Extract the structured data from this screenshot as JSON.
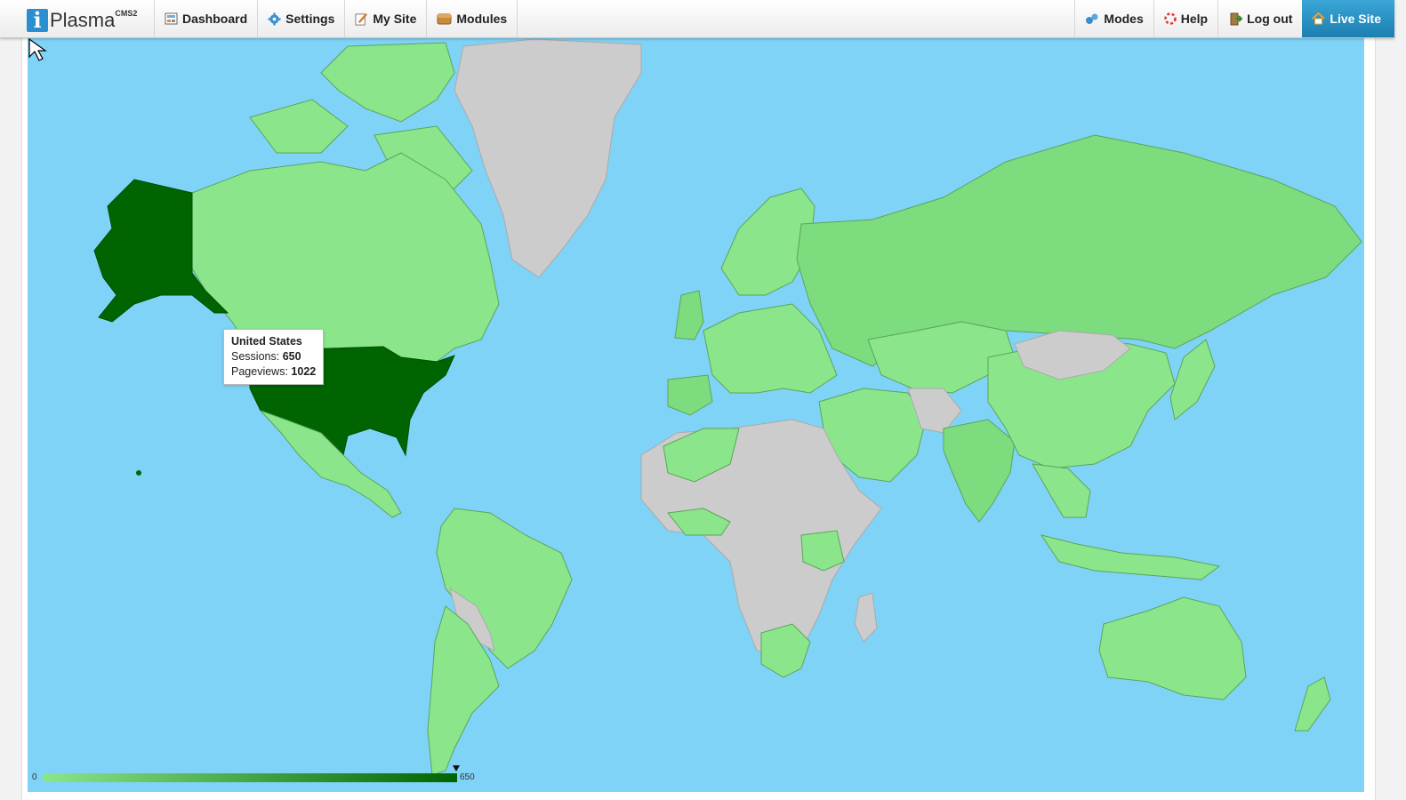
{
  "app": {
    "logo_letter": "i",
    "logo_name": "Plasma",
    "logo_suffix": "CMS2"
  },
  "nav_left": [
    {
      "label": "Dashboard",
      "icon": "dashboard-icon"
    },
    {
      "label": "Settings",
      "icon": "gear-icon"
    },
    {
      "label": "My Site",
      "icon": "edit-icon"
    },
    {
      "label": "Modules",
      "icon": "modules-icon"
    }
  ],
  "nav_right": [
    {
      "label": "Modes",
      "icon": "modes-icon"
    },
    {
      "label": "Help",
      "icon": "help-icon"
    },
    {
      "label": "Log out",
      "icon": "logout-icon"
    },
    {
      "label": "Live Site",
      "icon": "home-icon"
    }
  ],
  "tooltip": {
    "country": "United States",
    "sessions_label": "Sessions:",
    "sessions_value": "650",
    "pageviews_label": "Pageviews:",
    "pageviews_value": "1022"
  },
  "legend": {
    "min": "0",
    "max": "650",
    "current_fraction": 1.0
  },
  "colors": {
    "ocean": "#7fd3f7",
    "no_data": "#cccccc",
    "low": "#8be68b",
    "mid": "#7ddc7d",
    "high": "#006400",
    "topbar_live": "#2b93c6"
  }
}
